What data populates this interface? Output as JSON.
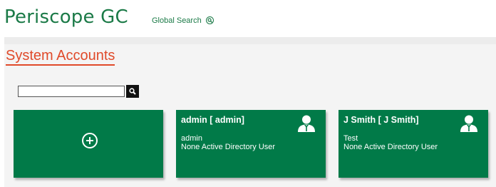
{
  "header": {
    "app_title": "Periscope GC",
    "global_search_label": "Global Search"
  },
  "page": {
    "title": "System Accounts",
    "search": {
      "value": "",
      "placeholder": ""
    }
  },
  "accounts": [
    {
      "name": "admin [ admin]",
      "line1": "admin",
      "line2": "None Active Directory User",
      "icon": "user-icon"
    },
    {
      "name": "J Smith [ J Smith]",
      "line1": "Test",
      "line2": "None Active Directory User",
      "icon": "user-icon"
    }
  ],
  "colors": {
    "brand_green": "#017a48",
    "title_accent": "#e04a2a",
    "header_text": "#1b7a47"
  }
}
